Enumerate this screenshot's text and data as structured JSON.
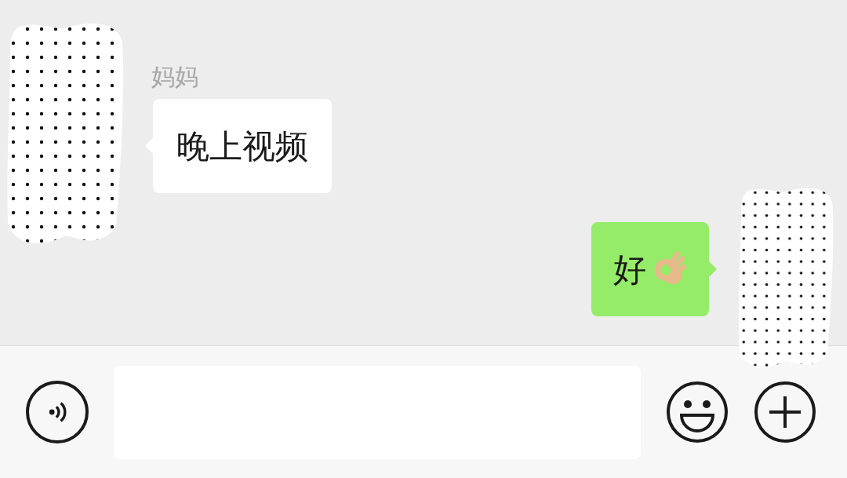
{
  "messages": [
    {
      "kind": "incoming",
      "sender": "妈妈",
      "text": "晚上视频"
    },
    {
      "kind": "outgoing",
      "text": "好",
      "ok_hand": true
    }
  ]
}
